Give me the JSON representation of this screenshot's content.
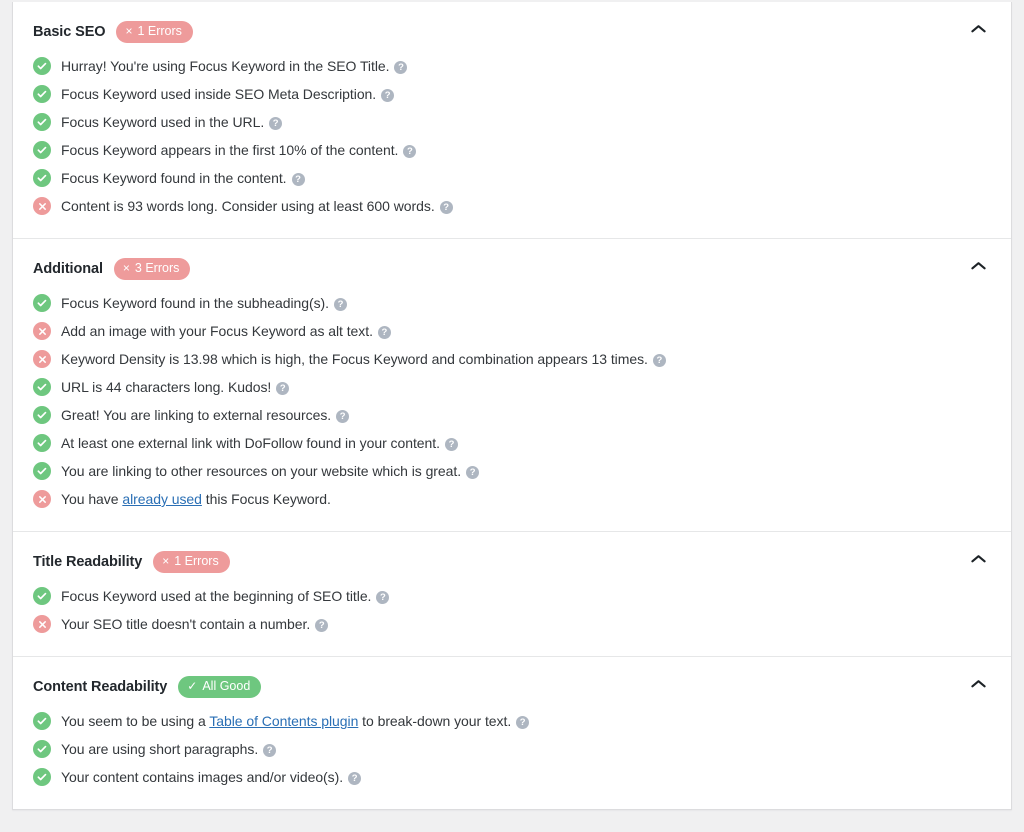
{
  "panel": {
    "name": "seo-analysis-panel",
    "sections": [
      {
        "id": "basic-seo",
        "title": "Basic SEO",
        "badge": {
          "type": "error",
          "symbol": "×",
          "label": "1 Errors"
        },
        "collapse_icon": "chevron-up-icon",
        "items": [
          {
            "status": "ok",
            "text": "Hurray! You're using Focus Keyword in the SEO Title.",
            "help": "?"
          },
          {
            "status": "ok",
            "text": "Focus Keyword used inside SEO Meta Description.",
            "help": "?"
          },
          {
            "status": "ok",
            "text": "Focus Keyword used in the URL.",
            "help": "?"
          },
          {
            "status": "ok",
            "text": "Focus Keyword appears in the first 10% of the content.",
            "help": "?"
          },
          {
            "status": "ok",
            "text": "Focus Keyword found in the content.",
            "help": "?"
          },
          {
            "status": "bad",
            "text": "Content is 93 words long. Consider using at least 600 words.",
            "help": "?"
          }
        ]
      },
      {
        "id": "additional",
        "title": "Additional",
        "badge": {
          "type": "error",
          "symbol": "×",
          "label": "3 Errors"
        },
        "collapse_icon": "chevron-up-icon",
        "items": [
          {
            "status": "ok",
            "text": "Focus Keyword found in the subheading(s).",
            "help": "?"
          },
          {
            "status": "bad",
            "text": "Add an image with your Focus Keyword as alt text.",
            "help": "?"
          },
          {
            "status": "bad",
            "text": "Keyword Density is 13.98 which is high, the Focus Keyword and combination appears 13 times.",
            "help": "?"
          },
          {
            "status": "ok",
            "text": "URL is 44 characters long. Kudos!",
            "help": "?"
          },
          {
            "status": "ok",
            "text": "Great! You are linking to external resources.",
            "help": "?"
          },
          {
            "status": "ok",
            "text": "At least one external link with DoFollow found in your content.",
            "help": "?"
          },
          {
            "status": "ok",
            "text": "You are linking to other resources on your website which is great.",
            "help": "?"
          },
          {
            "status": "bad",
            "text_before": "You have ",
            "link": "already used",
            "text_after": " this Focus Keyword.",
            "help": null
          }
        ]
      },
      {
        "id": "title-readability",
        "title": "Title Readability",
        "badge": {
          "type": "error",
          "symbol": "×",
          "label": "1 Errors"
        },
        "collapse_icon": "chevron-up-icon",
        "items": [
          {
            "status": "ok",
            "text": "Focus Keyword used at the beginning of SEO title.",
            "help": "?"
          },
          {
            "status": "bad",
            "text": "Your SEO title doesn't contain a number.",
            "help": "?"
          }
        ]
      },
      {
        "id": "content-readability",
        "title": "Content Readability",
        "badge": {
          "type": "good",
          "symbol": "✓",
          "label": "All Good"
        },
        "collapse_icon": "chevron-up-icon",
        "items": [
          {
            "status": "ok",
            "text_before": "You seem to be using a ",
            "link": "Table of Contents plugin",
            "text_after": " to break-down your text.",
            "help": "?"
          },
          {
            "status": "ok",
            "text": "You are using short paragraphs.",
            "help": "?"
          },
          {
            "status": "ok",
            "text": "Your content contains images and/or video(s).",
            "help": "?"
          }
        ]
      }
    ]
  },
  "colors": {
    "error_badge": "#ee9b9b",
    "good_badge": "#6ec77f",
    "ok_icon": "#6ec77f",
    "bad_icon": "#ee9b9b",
    "help_icon": "#aeb6c1",
    "link": "#2a6fb5",
    "text": "#34383c",
    "title": "#23282d",
    "page_bg": "#f0f0f1",
    "panel_bg": "#ffffff",
    "divider": "#e6e7e8"
  }
}
